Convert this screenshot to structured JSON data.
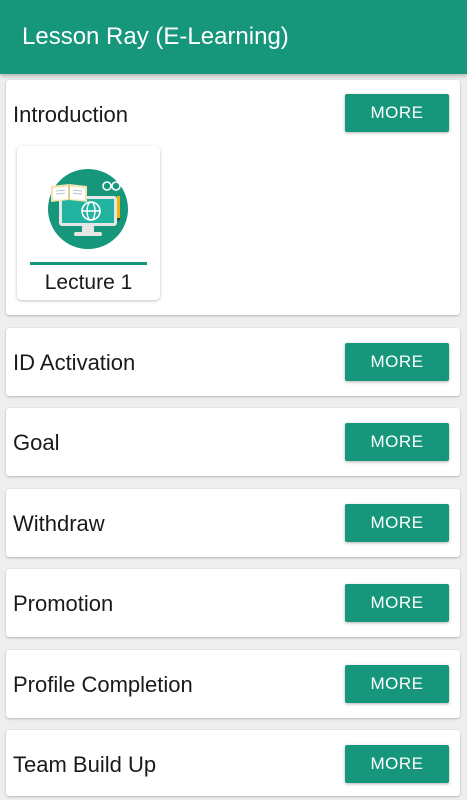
{
  "appbar": {
    "title": "Lesson Ray (E-Learning)"
  },
  "colors": {
    "primary": "#16967a",
    "background": "#eeeeee",
    "card": "#ffffff"
  },
  "sections": [
    {
      "label": "Introduction",
      "button": "MORE",
      "lectures": [
        {
          "label": "Lecture 1",
          "icon": "computer-book-globe-icon"
        }
      ]
    },
    {
      "label": "ID Activation",
      "button": "MORE"
    },
    {
      "label": "Goal",
      "button": "MORE"
    },
    {
      "label": "Withdraw",
      "button": "MORE"
    },
    {
      "label": "Promotion",
      "button": "MORE"
    },
    {
      "label": "Profile Completion",
      "button": "MORE"
    },
    {
      "label": "Team Build Up",
      "button": "MORE"
    }
  ]
}
